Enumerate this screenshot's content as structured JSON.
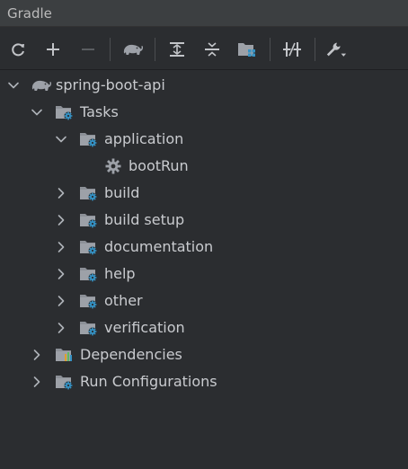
{
  "window": {
    "title": "Gradle"
  },
  "toolbar": {
    "buttons": [
      {
        "name": "reload-icon",
        "tooltip": "Reload All Gradle Projects"
      },
      {
        "name": "add-icon",
        "tooltip": "Link Gradle Project"
      },
      {
        "name": "remove-icon",
        "tooltip": "Unlink Gradle Project"
      },
      {
        "name": "gradle-elephant-icon",
        "tooltip": "Execute Gradle Task"
      },
      {
        "name": "expand-all-icon",
        "tooltip": "Expand All"
      },
      {
        "name": "collapse-all-icon",
        "tooltip": "Collapse All"
      },
      {
        "name": "project-folder-icon",
        "tooltip": "Group Modules"
      },
      {
        "name": "toggle-offline-icon",
        "tooltip": "Toggle Offline Mode"
      },
      {
        "name": "wrench-icon",
        "tooltip": "Build Tool Settings"
      }
    ]
  },
  "tree": {
    "project": {
      "label": "spring-boot-api",
      "expanded": true
    },
    "tasks": {
      "label": "Tasks",
      "expanded": true
    },
    "task_groups": [
      {
        "label": "application",
        "expanded": true,
        "children": [
          {
            "label": "bootRun"
          }
        ]
      },
      {
        "label": "build",
        "expanded": false
      },
      {
        "label": "build setup",
        "expanded": false
      },
      {
        "label": "documentation",
        "expanded": false
      },
      {
        "label": "help",
        "expanded": false
      },
      {
        "label": "other",
        "expanded": false
      },
      {
        "label": "verification",
        "expanded": false
      }
    ],
    "dependencies": {
      "label": "Dependencies",
      "expanded": false
    },
    "run_configurations": {
      "label": "Run Configurations",
      "expanded": false
    }
  },
  "colors": {
    "background": "#2b2d30",
    "text": "#c9cbcf",
    "folder": "#8c9097",
    "gear_blue": "#3592c4",
    "chevron": "#aeb2b8"
  }
}
